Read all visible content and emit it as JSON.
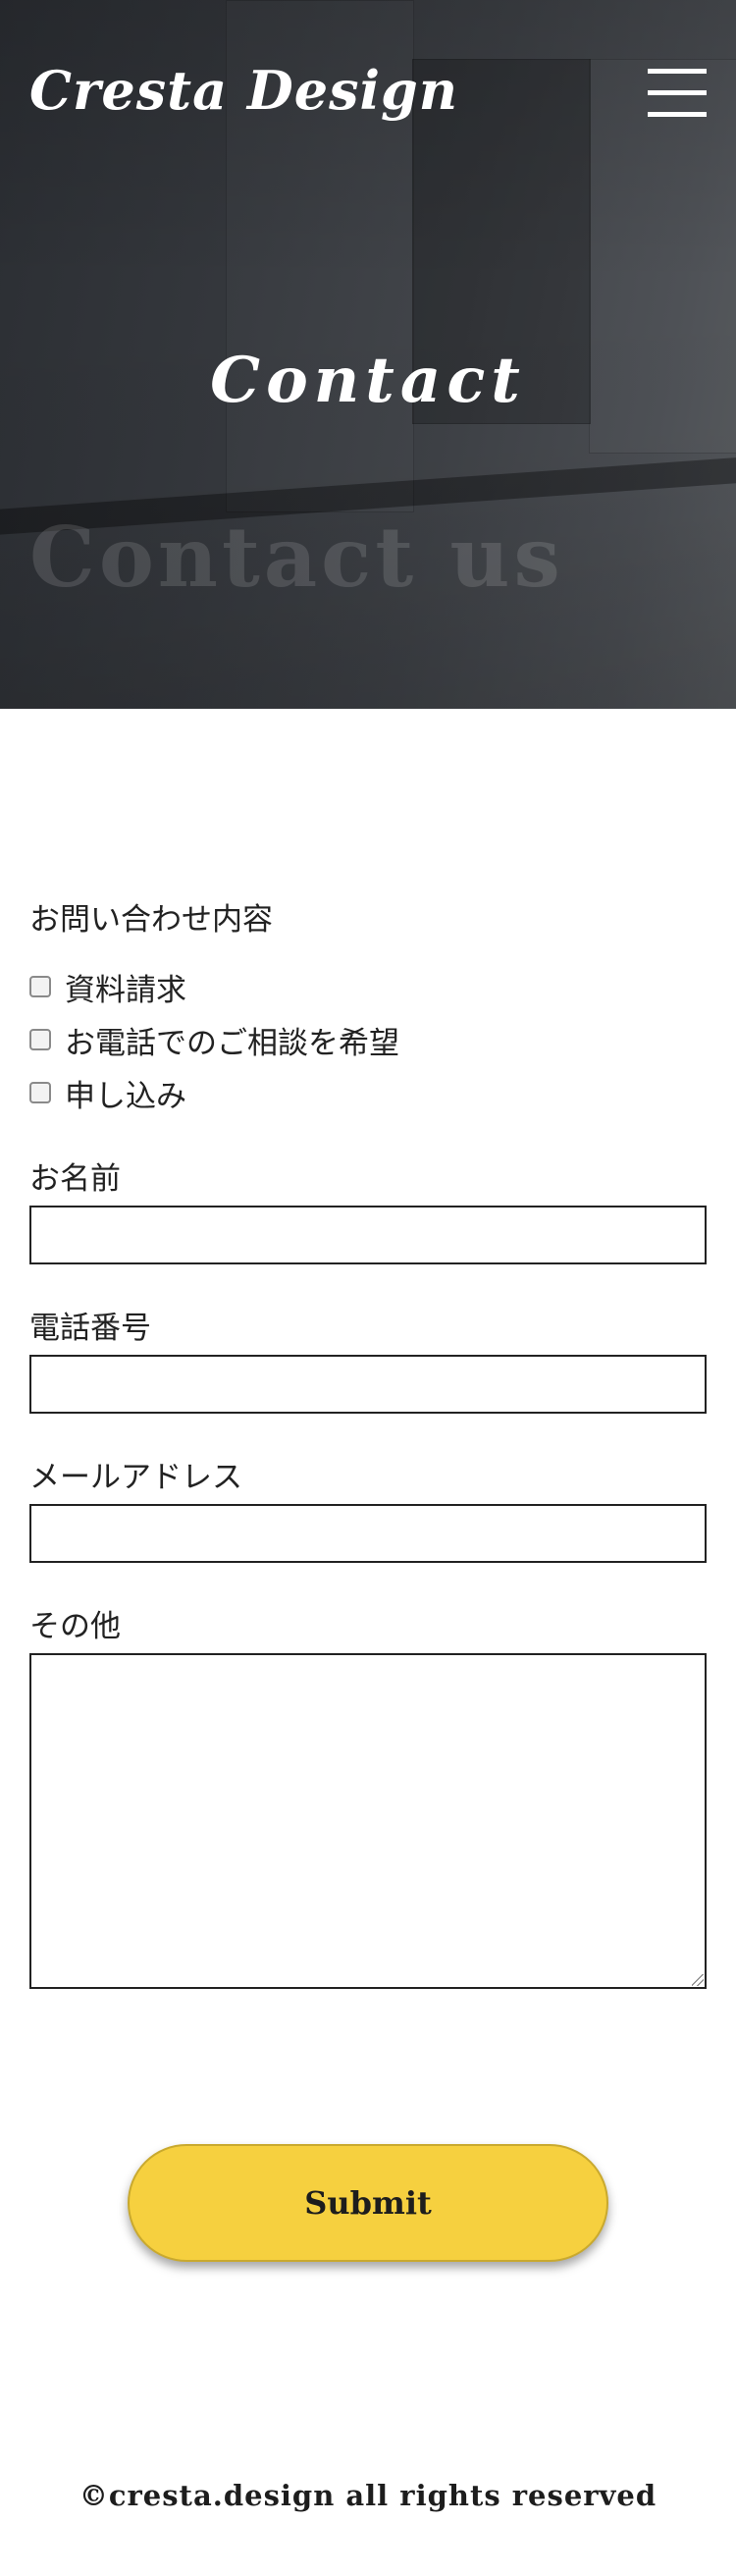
{
  "header": {
    "logo": "Cresta Design",
    "menu_icon": "hamburger-menu-icon"
  },
  "hero": {
    "title": "Contact",
    "subtitle": "Contact us"
  },
  "form": {
    "inquiry_label": "お問い合わせ内容",
    "checkboxes": [
      {
        "label": "資料請求",
        "checked": false
      },
      {
        "label": "お電話でのご相談を希望",
        "checked": false
      },
      {
        "label": "申し込み",
        "checked": false
      }
    ],
    "name_label": "お名前",
    "name_value": "",
    "phone_label": "電話番号",
    "phone_value": "",
    "email_label": "メールアドレス",
    "email_value": "",
    "other_label": "その他",
    "other_value": "",
    "submit_label": "Submit"
  },
  "colors": {
    "submit_bg": "#f6d03f",
    "hero_bg": "#35383d",
    "text": "#222222"
  },
  "footer": {
    "copyright": "©cresta.design all rights reserved"
  }
}
